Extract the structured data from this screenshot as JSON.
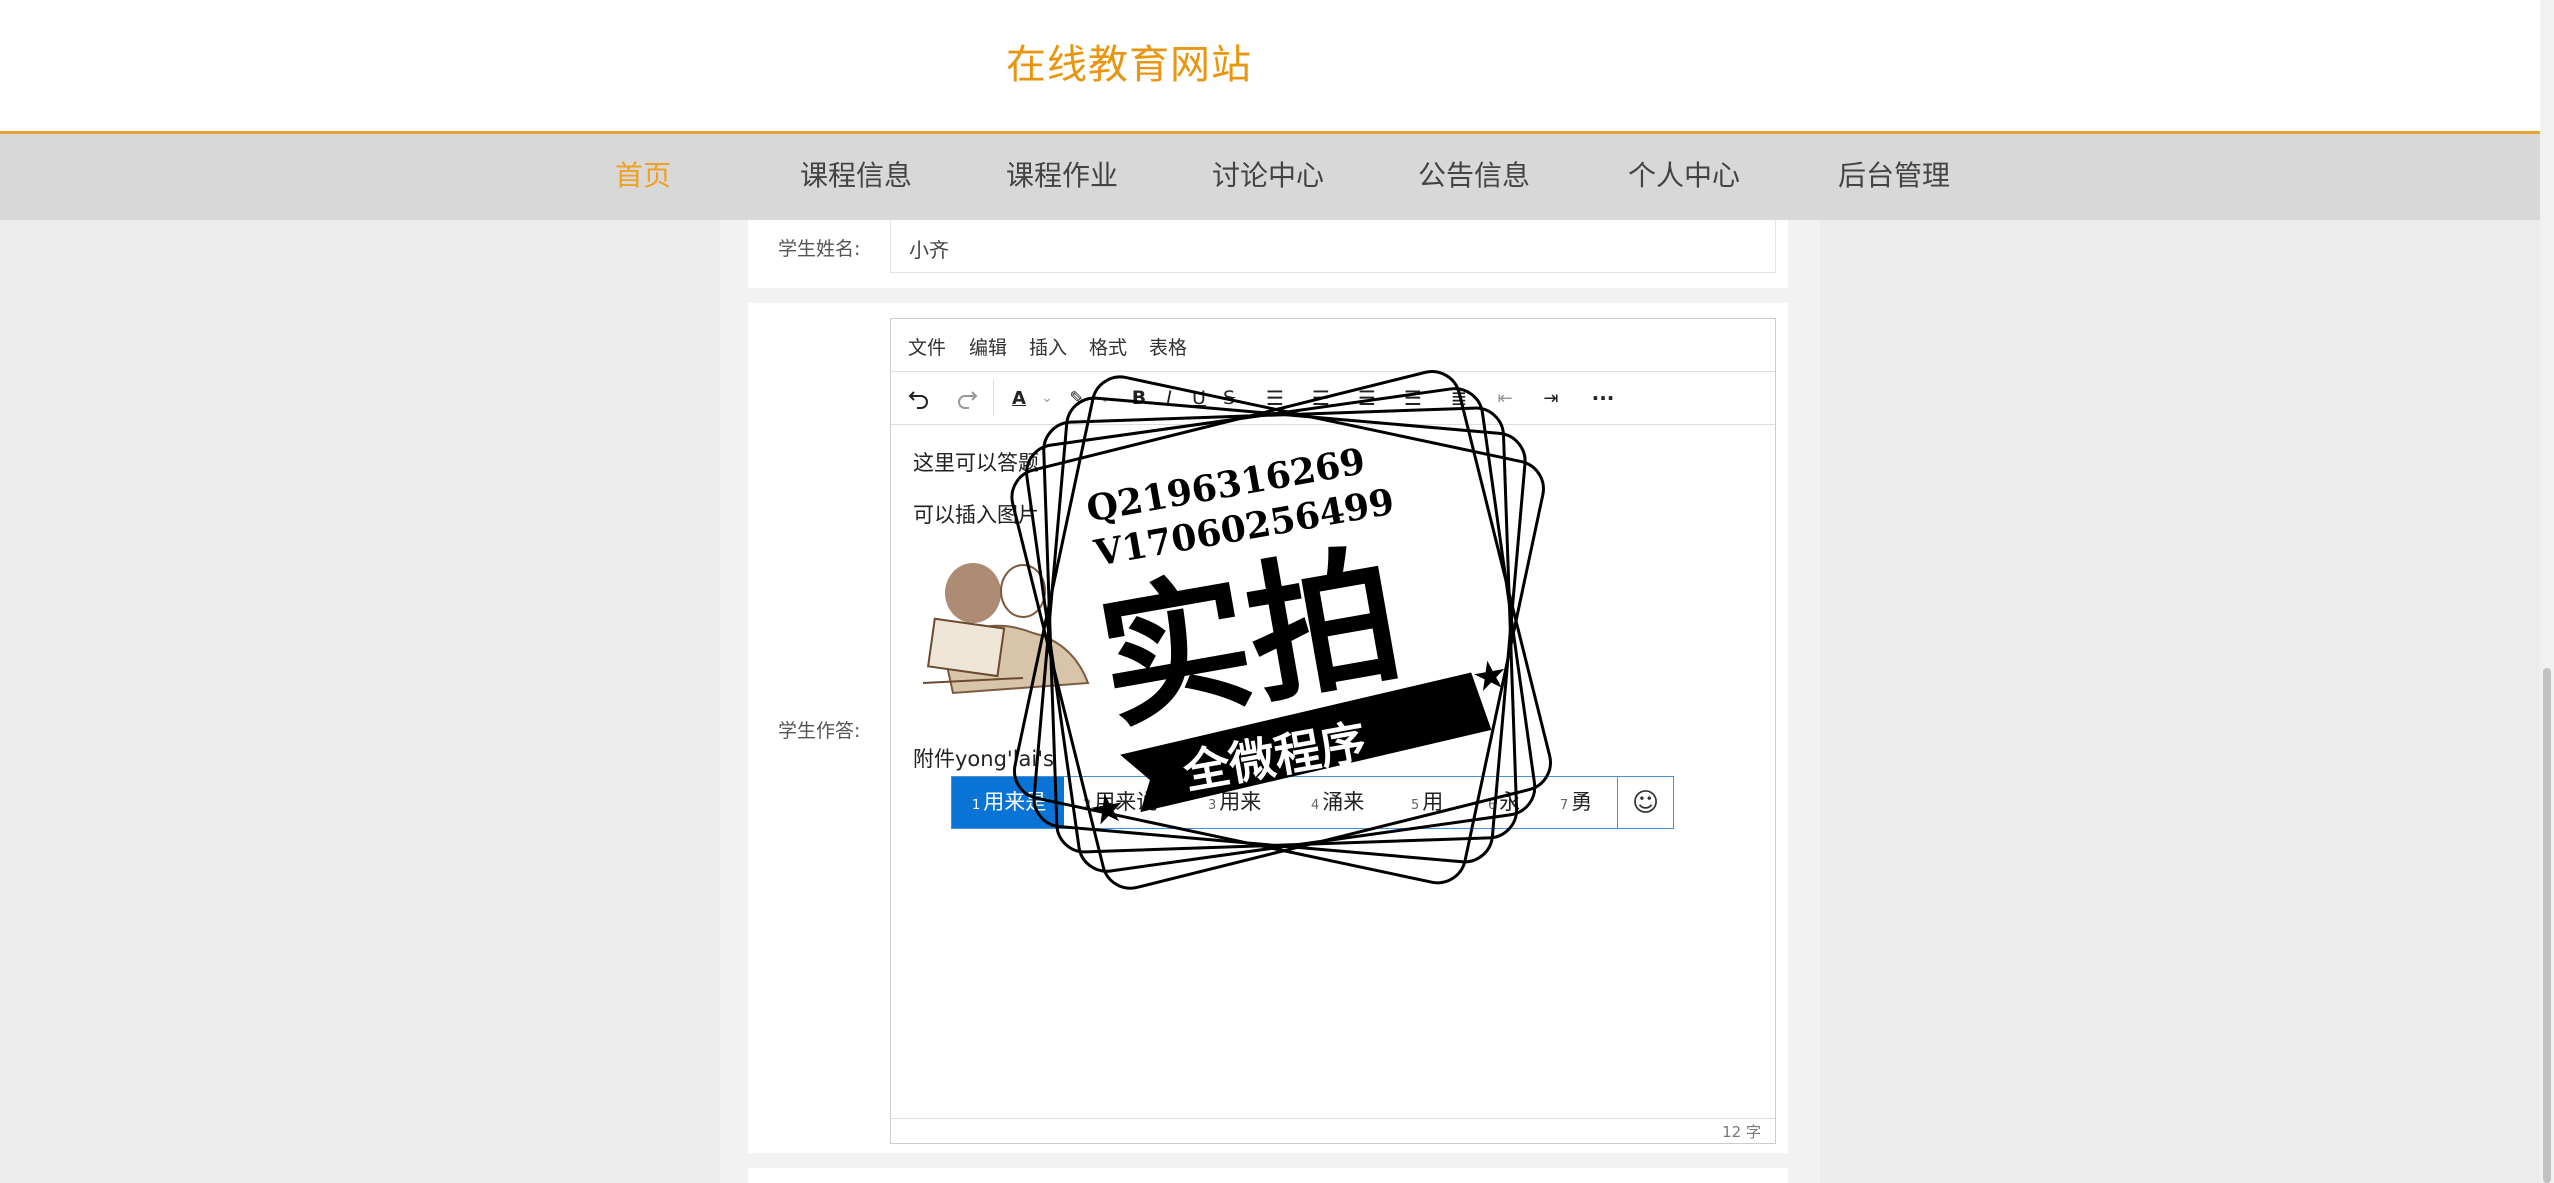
{
  "header": {
    "site_title": "在线教育网站"
  },
  "nav": {
    "items": [
      "首页",
      "课程信息",
      "课程作业",
      "讨论中心",
      "公告信息",
      "个人中心",
      "后台管理"
    ],
    "active_color": "#f0a020"
  },
  "form": {
    "student_name_label": "学生姓名:",
    "student_name_value": "小齐",
    "answer_label": "学生作答:"
  },
  "editor": {
    "menu": [
      "文件",
      "编辑",
      "插入",
      "格式",
      "表格"
    ],
    "toolbar_icons": [
      "undo-icon",
      "redo-icon",
      "font-color-icon",
      "highlight-icon",
      "bold-icon",
      "italic-icon",
      "underline-icon",
      "strikethrough-icon",
      "list-icon",
      "align-left-icon",
      "align-center-icon",
      "align-right-icon",
      "justify-icon",
      "outdent-icon",
      "indent-icon",
      "more-icon"
    ],
    "lines": [
      "这里可以答题",
      "可以插入图片"
    ],
    "attachment_line": "附件yong'lai's",
    "word_count": "12 字"
  },
  "ime": {
    "candidates": [
      {
        "n": "1",
        "text": "用来是"
      },
      {
        "n": "2",
        "text": "用来说"
      },
      {
        "n": "3",
        "text": "用来"
      },
      {
        "n": "4",
        "text": "涌来"
      },
      {
        "n": "5",
        "text": "用"
      },
      {
        "n": "6",
        "text": "永"
      },
      {
        "n": "7",
        "text": "勇"
      }
    ],
    "emoji": "☺"
  },
  "watermark": {
    "line1": "Q2196316269",
    "line2": "V17060256499",
    "big": "实拍",
    "ribbon": "全微程序"
  }
}
